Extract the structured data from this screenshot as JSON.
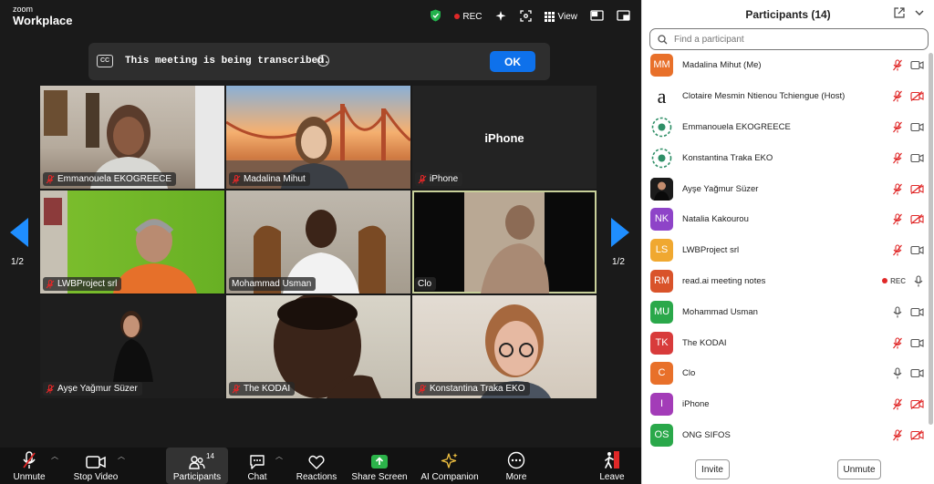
{
  "app": {
    "brand_top": "zoom",
    "brand_bottom": "Workplace"
  },
  "topbar": {
    "rec_label": "REC",
    "view_label": "View"
  },
  "banner": {
    "text": "This meeting is being transcribed.",
    "ok_label": "OK"
  },
  "pager": {
    "left": "1/2",
    "right": "1/2"
  },
  "tiles": [
    {
      "name": "Emmanouela EKOGREECE",
      "muted": true
    },
    {
      "name": "Madalina Mihut",
      "muted": true
    },
    {
      "name": "iPhone",
      "muted": true,
      "center_text": "iPhone"
    },
    {
      "name": "LWBProject srl",
      "muted": true
    },
    {
      "name": "Mohammad Usman",
      "muted": false
    },
    {
      "name": "Clo",
      "muted": false
    },
    {
      "name": "Ayşe Yağmur Süzer",
      "muted": true
    },
    {
      "name": "The KODAI",
      "muted": true
    },
    {
      "name": "Konstantina Traka EKO",
      "muted": true
    }
  ],
  "toolbar": {
    "unmute": "Unmute",
    "stop_video": "Stop Video",
    "participants": "Participants",
    "participants_count": "14",
    "chat": "Chat",
    "reactions": "Reactions",
    "share_screen": "Share Screen",
    "ai_companion": "AI Companion",
    "more": "More",
    "leave": "Leave"
  },
  "panel": {
    "title": "Participants (14)",
    "search_placeholder": "Find a participant",
    "invite_label": "Invite",
    "unmute_label": "Unmute",
    "participants": [
      {
        "initials": "MM",
        "color": "#e8702a",
        "name": "Madalina Mihut (Me)",
        "mic": "muted",
        "video": "on"
      },
      {
        "initials": "",
        "color": "#ffffff",
        "name": "Clotaire Mesmin Ntienou Tchiengue (Host)",
        "mic": "muted",
        "video": "off"
      },
      {
        "initials": "",
        "color": "#ffffff",
        "name": "Emmanouela EKOGREECE",
        "mic": "muted",
        "video": "on"
      },
      {
        "initials": "",
        "color": "#ffffff",
        "name": "Konstantina Traka EKO",
        "mic": "muted",
        "video": "on"
      },
      {
        "initials": "",
        "color": "#222222",
        "name": "Ayşe Yağmur Süzer",
        "mic": "muted",
        "video": "off"
      },
      {
        "initials": "NK",
        "color": "#8e44c8",
        "name": "Natalia Kakourou",
        "mic": "muted",
        "video": "off"
      },
      {
        "initials": "LS",
        "color": "#f0a830",
        "name": "LWBProject srl",
        "mic": "muted",
        "video": "on"
      },
      {
        "initials": "RM",
        "color": "#d9532a",
        "name": "read.ai meeting notes",
        "mic": "on",
        "video": "rec",
        "rec_label": "REC"
      },
      {
        "initials": "MU",
        "color": "#2aa84a",
        "name": "Mohammad Usman",
        "mic": "on",
        "video": "on"
      },
      {
        "initials": "TK",
        "color": "#d83b3b",
        "name": "The KODAI",
        "mic": "muted",
        "video": "on"
      },
      {
        "initials": "C",
        "color": "#e8702a",
        "name": "Clo",
        "mic": "on",
        "video": "on"
      },
      {
        "initials": "I",
        "color": "#a33cb8",
        "name": "iPhone",
        "mic": "muted",
        "video": "off"
      },
      {
        "initials": "OS",
        "color": "#2aa84a",
        "name": "ONG SIFOS",
        "mic": "muted",
        "video": "off"
      }
    ]
  },
  "colors": {
    "accent": "#0e71eb",
    "mute_red": "#e02828",
    "share_green": "#2cb34a"
  }
}
